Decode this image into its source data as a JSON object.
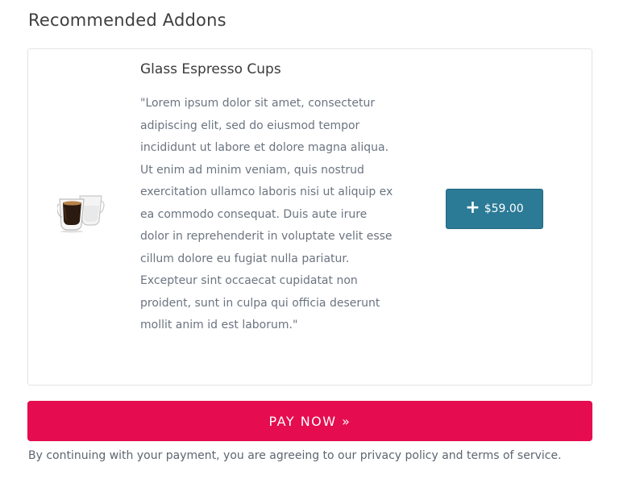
{
  "section": {
    "title": "Recommended Addons"
  },
  "addon": {
    "name": "Glass Espresso Cups",
    "description": "\"Lorem ipsum dolor sit amet, consectetur adipiscing elit, sed do eiusmod tempor incididunt ut labore et dolore magna aliqua. Ut enim ad minim veniam, quis nostrud exercitation ullamco laboris nisi ut aliquip ex ea commodo consequat. Duis aute irure dolor in reprehenderit in voluptate velit esse cillum dolore eu fugiat nulla pariatur. Excepteur sint occaecat cupidatat non proident, sunt in culpa qui officia deserunt mollit anim id est laborum.\"",
    "image_icon": "espresso-cups-image",
    "add_icon": "plus-icon",
    "price": "$59.00"
  },
  "checkout": {
    "pay_label": "PAY NOW »",
    "terms_text": "By continuing with your payment, you are agreeing to our privacy policy and terms of service."
  },
  "colors": {
    "pay_button": "#e50c4f",
    "add_button": "#2b7a96"
  }
}
